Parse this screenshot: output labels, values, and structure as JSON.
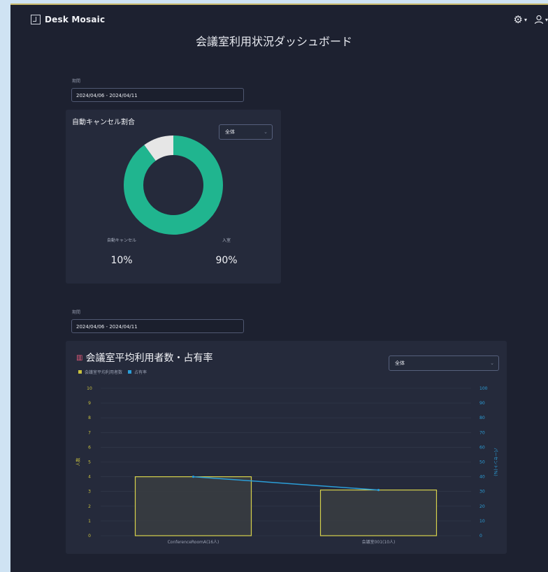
{
  "app": {
    "brand": "Desk Mosaic",
    "icons": [
      "grid-logo-icon",
      "gear-icon",
      "user-icon"
    ]
  },
  "page": {
    "title": "会議室利用状況ダッシュボード"
  },
  "section1": {
    "period_label": "期間",
    "date_range": "2024/04/06 - 2024/04/11",
    "card": {
      "title": "自動キャンセル割合",
      "select_value": "全体",
      "labels": {
        "left": "自動キャンセル",
        "right": "入室"
      },
      "values": {
        "left": "10%",
        "right": "90%"
      }
    }
  },
  "section2": {
    "period_label": "期間",
    "date_range": "2024/04/06 - 2024/04/11",
    "card": {
      "title": "会議室平均利用者数・占有率",
      "select_value": "全体",
      "legend": [
        "会議室平均利用者数",
        "占有率"
      ]
    }
  },
  "colors": {
    "teal": "#20b58f",
    "gray_slice": "#e6e6e6",
    "bar_fill": "#3a3d42",
    "bar_stroke": "#d7d24c",
    "line": "#2b9ed8",
    "left_axis": "#c9c13f",
    "right_axis": "#2b9ed8"
  },
  "chart_data": [
    {
      "type": "pie",
      "title": "自動キャンセル割合",
      "categories": [
        "自動キャンセル",
        "入室"
      ],
      "values": [
        10,
        90
      ],
      "colors": [
        "#e6e6e6",
        "#20b58f"
      ]
    },
    {
      "type": "bar",
      "title": "会議室平均利用者数・占有率",
      "categories": [
        "ConferenceRoomA(16人)",
        "会議室001(10人)"
      ],
      "series": [
        {
          "name": "会議室平均利用者数",
          "type": "bar",
          "values": [
            4,
            3.1
          ],
          "axis": "left"
        },
        {
          "name": "占有率",
          "type": "line",
          "values": [
            40,
            31
          ],
          "axis": "right"
        }
      ],
      "ylabel": "人数",
      "ylabel_right": "パーセント(%)",
      "ylim": [
        0,
        10
      ],
      "ylim_right": [
        0,
        100
      ],
      "yticks": [
        "0",
        "1",
        "2",
        "3",
        "4",
        "5",
        "6",
        "7",
        "8",
        "9",
        "10"
      ],
      "yticks_right": [
        "0",
        "10",
        "20",
        "30",
        "40",
        "50",
        "60",
        "70",
        "80",
        "90",
        "100"
      ],
      "grid": true
    }
  ]
}
